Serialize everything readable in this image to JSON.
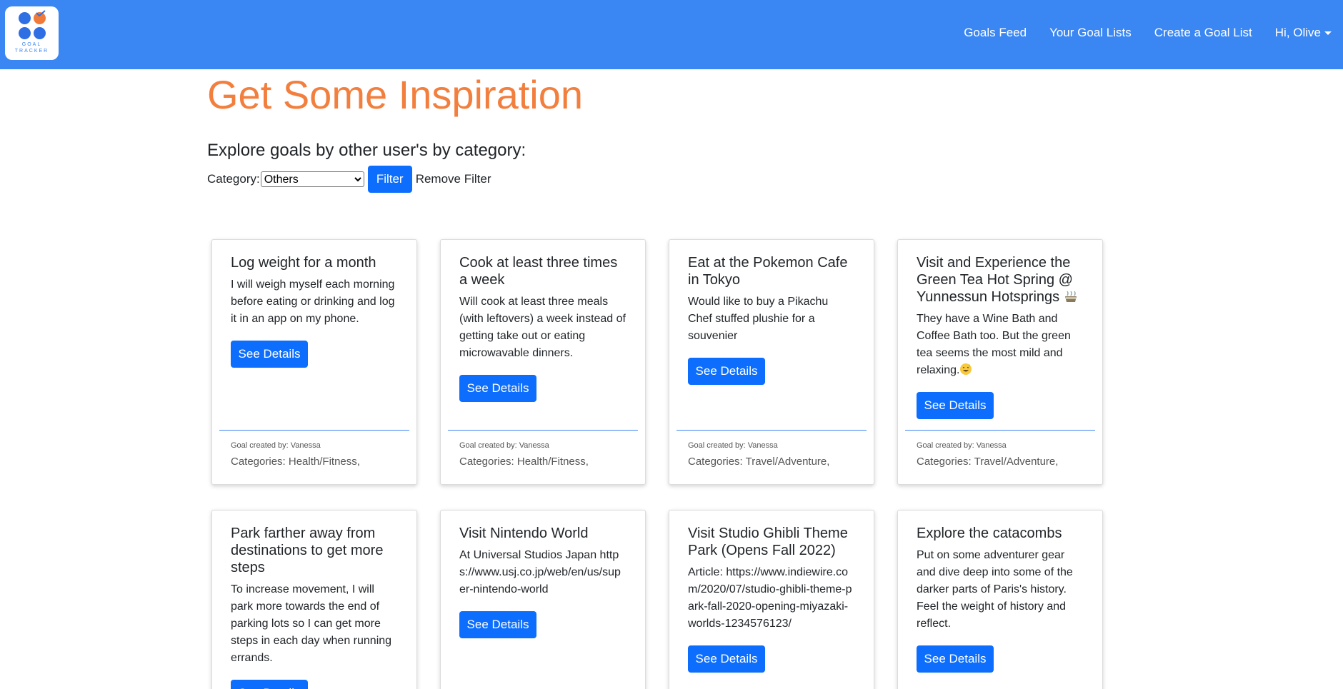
{
  "navbar": {
    "logo_text_line1": "GOAL",
    "logo_text_line2": "TRACKER",
    "links": [
      "Goals Feed",
      "Your Goal Lists",
      "Create a Goal List",
      "Hi, Olive"
    ]
  },
  "page": {
    "title": "Get Some Inspiration",
    "subtitle": "Explore goals by other user's by category:"
  },
  "filter": {
    "label": "Category:",
    "selected": "Others",
    "button": "Filter",
    "remove": "Remove Filter"
  },
  "cards": [
    {
      "title": "Log weight for a month",
      "text": "I will weigh myself each morning before eating or drinking and log it in an app on my phone.",
      "button": "See Details",
      "creator": "Goal created by: Vanessa",
      "categories": "Categories: Health/Fitness,"
    },
    {
      "title": "Cook at least three times a week",
      "text": "Will cook at least three meals (with leftovers) a week instead of getting take out or eating microwavable dinners.",
      "button": "See Details",
      "creator": "Goal created by: Vanessa",
      "categories": "Categories: Health/Fitness,"
    },
    {
      "title": "Eat at the Pokemon Cafe in Tokyo",
      "text": "Would like to buy a Pikachu Chef stuffed plushie for a souvenier",
      "button": "See Details",
      "creator": "Goal created by: Vanessa",
      "categories": "Categories: Travel/Adventure,"
    },
    {
      "title": "Visit and Experience the Green Tea Hot Spring @ Yunnessun Hotsprings",
      "text": "They have a Wine Bath and Coffee Bath too. But the green tea seems the most mild and relaxing.",
      "button": "See Details",
      "creator": "Goal created by: Vanessa",
      "categories": "Categories: Travel/Adventure,"
    },
    {
      "title": "Park farther away from destinations to get more steps",
      "text": "To increase movement, I will park more towards the end of parking lots so I can get more steps in each day when running errands.",
      "button": "See Details"
    },
    {
      "title": "Visit Nintendo World",
      "text": "At Universal Studios Japan https://www.usj.co.jp/web/en/us/super-nintendo-world",
      "button": "See Details"
    },
    {
      "title": "Visit Studio Ghibli Theme Park (Opens Fall 2022)",
      "text": "Article: https://www.indiewire.com/2020/07/studio-ghibli-theme-park-fall-2020-opening-miyazaki-worlds-1234576123/",
      "button": "See Details"
    },
    {
      "title": "Explore the catacombs",
      "text": "Put on some adventurer gear and dive deep into some of the darker parts of Paris's history. Feel the weight of history and reflect.",
      "button": "See Details"
    }
  ]
}
